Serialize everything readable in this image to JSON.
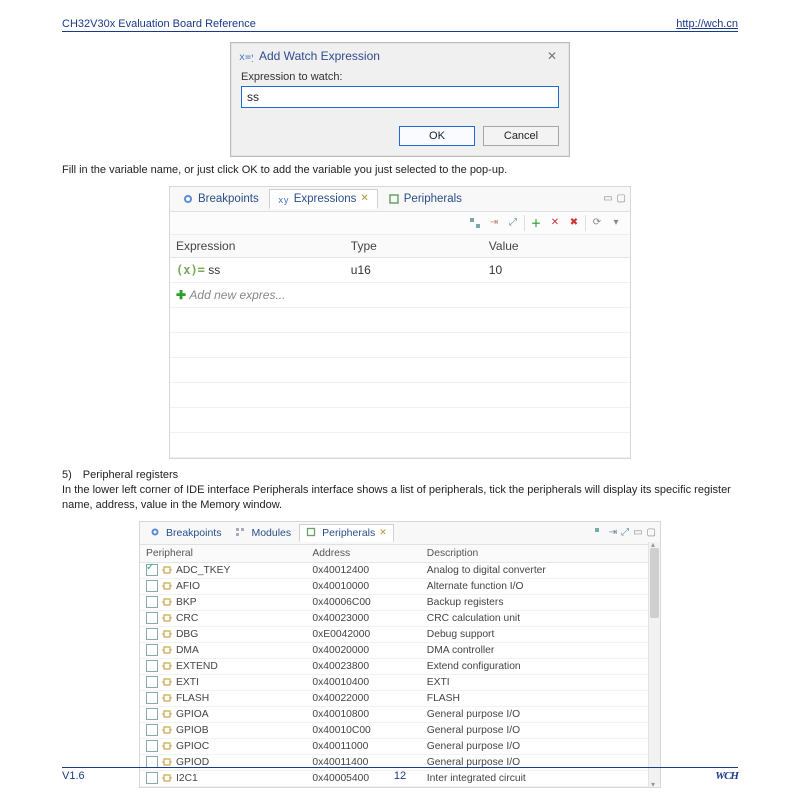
{
  "header": {
    "doc_title": "CH32V30x Evaluation Board Reference",
    "url": "http://wch.cn"
  },
  "footer": {
    "version": "V1.6",
    "page": "12",
    "vendor": "WCH"
  },
  "dialog": {
    "title": "Add Watch Expression",
    "label": "Expression to watch:",
    "value": "ss",
    "ok": "OK",
    "cancel": "Cancel"
  },
  "caption1": "Fill in the variable name, or just click OK to add the variable you just selected to the pop-up.",
  "expr_view": {
    "tabs": {
      "breakpoints": "Breakpoints",
      "expressions": "Expressions",
      "peripherals": "Peripherals"
    },
    "columns": {
      "expr": "Expression",
      "type": "Type",
      "value": "Value"
    },
    "rows": [
      {
        "expr": "ss",
        "type": "u16",
        "value": "10"
      }
    ],
    "add_new": "Add new expres..."
  },
  "section5_title": "5) Peripheral registers",
  "section5_body": "In the lower left corner of IDE interface Peripherals interface shows a list of peripherals, tick the peripherals will display its specific register name, address, value in the Memory window.",
  "periph_view": {
    "tabs": {
      "breakpoints": "Breakpoints",
      "modules": "Modules",
      "peripherals": "Peripherals"
    },
    "columns": {
      "periph": "Peripheral",
      "addr": "Address",
      "desc": "Description"
    },
    "rows": [
      {
        "checked": true,
        "name": "ADC_TKEY",
        "addr": "0x40012400",
        "desc": "Analog to digital converter"
      },
      {
        "checked": false,
        "name": "AFIO",
        "addr": "0x40010000",
        "desc": "Alternate function I/O"
      },
      {
        "checked": false,
        "name": "BKP",
        "addr": "0x40006C00",
        "desc": "Backup registers"
      },
      {
        "checked": false,
        "name": "CRC",
        "addr": "0x40023000",
        "desc": "CRC calculation unit"
      },
      {
        "checked": false,
        "name": "DBG",
        "addr": "0xE0042000",
        "desc": "Debug support"
      },
      {
        "checked": false,
        "name": "DMA",
        "addr": "0x40020000",
        "desc": "DMA controller"
      },
      {
        "checked": false,
        "name": "EXTEND",
        "addr": "0x40023800",
        "desc": "Extend configuration"
      },
      {
        "checked": false,
        "name": "EXTI",
        "addr": "0x40010400",
        "desc": "EXTI"
      },
      {
        "checked": false,
        "name": "FLASH",
        "addr": "0x40022000",
        "desc": "FLASH"
      },
      {
        "checked": false,
        "name": "GPIOA",
        "addr": "0x40010800",
        "desc": "General purpose I/O"
      },
      {
        "checked": false,
        "name": "GPIOB",
        "addr": "0x40010C00",
        "desc": "General purpose I/O"
      },
      {
        "checked": false,
        "name": "GPIOC",
        "addr": "0x40011000",
        "desc": "General purpose I/O"
      },
      {
        "checked": false,
        "name": "GPIOD",
        "addr": "0x40011400",
        "desc": "General purpose I/O"
      },
      {
        "checked": false,
        "name": "I2C1",
        "addr": "0x40005400",
        "desc": "Inter integrated circuit"
      }
    ]
  }
}
